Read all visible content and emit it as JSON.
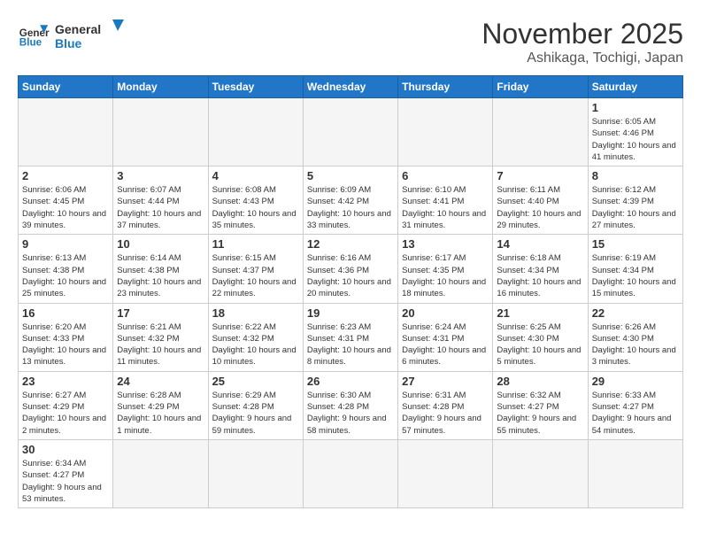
{
  "logo": {
    "text_general": "General",
    "text_blue": "Blue"
  },
  "header": {
    "month_title": "November 2025",
    "location": "Ashikaga, Tochigi, Japan"
  },
  "days_of_week": [
    "Sunday",
    "Monday",
    "Tuesday",
    "Wednesday",
    "Thursday",
    "Friday",
    "Saturday"
  ],
  "weeks": [
    [
      {
        "day": "",
        "info": ""
      },
      {
        "day": "",
        "info": ""
      },
      {
        "day": "",
        "info": ""
      },
      {
        "day": "",
        "info": ""
      },
      {
        "day": "",
        "info": ""
      },
      {
        "day": "",
        "info": ""
      },
      {
        "day": "1",
        "info": "Sunrise: 6:05 AM\nSunset: 4:46 PM\nDaylight: 10 hours and 41 minutes."
      }
    ],
    [
      {
        "day": "2",
        "info": "Sunrise: 6:06 AM\nSunset: 4:45 PM\nDaylight: 10 hours and 39 minutes."
      },
      {
        "day": "3",
        "info": "Sunrise: 6:07 AM\nSunset: 4:44 PM\nDaylight: 10 hours and 37 minutes."
      },
      {
        "day": "4",
        "info": "Sunrise: 6:08 AM\nSunset: 4:43 PM\nDaylight: 10 hours and 35 minutes."
      },
      {
        "day": "5",
        "info": "Sunrise: 6:09 AM\nSunset: 4:42 PM\nDaylight: 10 hours and 33 minutes."
      },
      {
        "day": "6",
        "info": "Sunrise: 6:10 AM\nSunset: 4:41 PM\nDaylight: 10 hours and 31 minutes."
      },
      {
        "day": "7",
        "info": "Sunrise: 6:11 AM\nSunset: 4:40 PM\nDaylight: 10 hours and 29 minutes."
      },
      {
        "day": "8",
        "info": "Sunrise: 6:12 AM\nSunset: 4:39 PM\nDaylight: 10 hours and 27 minutes."
      }
    ],
    [
      {
        "day": "9",
        "info": "Sunrise: 6:13 AM\nSunset: 4:38 PM\nDaylight: 10 hours and 25 minutes."
      },
      {
        "day": "10",
        "info": "Sunrise: 6:14 AM\nSunset: 4:38 PM\nDaylight: 10 hours and 23 minutes."
      },
      {
        "day": "11",
        "info": "Sunrise: 6:15 AM\nSunset: 4:37 PM\nDaylight: 10 hours and 22 minutes."
      },
      {
        "day": "12",
        "info": "Sunrise: 6:16 AM\nSunset: 4:36 PM\nDaylight: 10 hours and 20 minutes."
      },
      {
        "day": "13",
        "info": "Sunrise: 6:17 AM\nSunset: 4:35 PM\nDaylight: 10 hours and 18 minutes."
      },
      {
        "day": "14",
        "info": "Sunrise: 6:18 AM\nSunset: 4:34 PM\nDaylight: 10 hours and 16 minutes."
      },
      {
        "day": "15",
        "info": "Sunrise: 6:19 AM\nSunset: 4:34 PM\nDaylight: 10 hours and 15 minutes."
      }
    ],
    [
      {
        "day": "16",
        "info": "Sunrise: 6:20 AM\nSunset: 4:33 PM\nDaylight: 10 hours and 13 minutes."
      },
      {
        "day": "17",
        "info": "Sunrise: 6:21 AM\nSunset: 4:32 PM\nDaylight: 10 hours and 11 minutes."
      },
      {
        "day": "18",
        "info": "Sunrise: 6:22 AM\nSunset: 4:32 PM\nDaylight: 10 hours and 10 minutes."
      },
      {
        "day": "19",
        "info": "Sunrise: 6:23 AM\nSunset: 4:31 PM\nDaylight: 10 hours and 8 minutes."
      },
      {
        "day": "20",
        "info": "Sunrise: 6:24 AM\nSunset: 4:31 PM\nDaylight: 10 hours and 6 minutes."
      },
      {
        "day": "21",
        "info": "Sunrise: 6:25 AM\nSunset: 4:30 PM\nDaylight: 10 hours and 5 minutes."
      },
      {
        "day": "22",
        "info": "Sunrise: 6:26 AM\nSunset: 4:30 PM\nDaylight: 10 hours and 3 minutes."
      }
    ],
    [
      {
        "day": "23",
        "info": "Sunrise: 6:27 AM\nSunset: 4:29 PM\nDaylight: 10 hours and 2 minutes."
      },
      {
        "day": "24",
        "info": "Sunrise: 6:28 AM\nSunset: 4:29 PM\nDaylight: 10 hours and 1 minute."
      },
      {
        "day": "25",
        "info": "Sunrise: 6:29 AM\nSunset: 4:28 PM\nDaylight: 9 hours and 59 minutes."
      },
      {
        "day": "26",
        "info": "Sunrise: 6:30 AM\nSunset: 4:28 PM\nDaylight: 9 hours and 58 minutes."
      },
      {
        "day": "27",
        "info": "Sunrise: 6:31 AM\nSunset: 4:28 PM\nDaylight: 9 hours and 57 minutes."
      },
      {
        "day": "28",
        "info": "Sunrise: 6:32 AM\nSunset: 4:27 PM\nDaylight: 9 hours and 55 minutes."
      },
      {
        "day": "29",
        "info": "Sunrise: 6:33 AM\nSunset: 4:27 PM\nDaylight: 9 hours and 54 minutes."
      }
    ],
    [
      {
        "day": "30",
        "info": "Sunrise: 6:34 AM\nSunset: 4:27 PM\nDaylight: 9 hours and 53 minutes."
      },
      {
        "day": "",
        "info": ""
      },
      {
        "day": "",
        "info": ""
      },
      {
        "day": "",
        "info": ""
      },
      {
        "day": "",
        "info": ""
      },
      {
        "day": "",
        "info": ""
      },
      {
        "day": "",
        "info": ""
      }
    ]
  ]
}
